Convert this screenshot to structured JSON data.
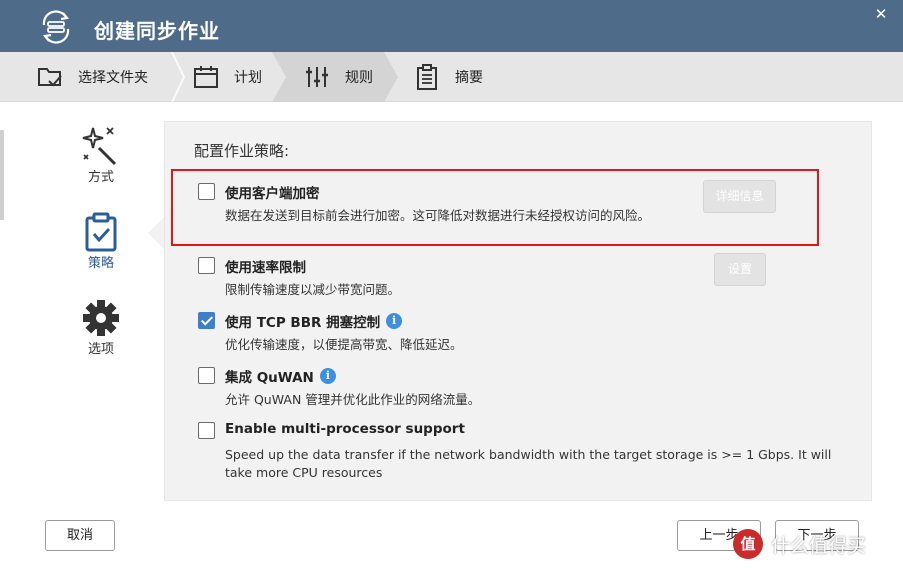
{
  "window": {
    "title": "创建同步作业",
    "close_glyph": "✕"
  },
  "steps": [
    {
      "label": "选择文件夹",
      "icon": "folder-check-icon"
    },
    {
      "label": "计划",
      "icon": "calendar-icon"
    },
    {
      "label": "规则",
      "icon": "sliders-icon",
      "active": true
    },
    {
      "label": "摘要",
      "icon": "clipboard-list-icon"
    }
  ],
  "sidenav": [
    {
      "label": "方式",
      "icon": "magic-wand-icon"
    },
    {
      "label": "策略",
      "icon": "clipboard-check-icon",
      "active": true
    },
    {
      "label": "选项",
      "icon": "gear-icon"
    }
  ],
  "section_title": "配置作业策略:",
  "options": [
    {
      "label": "使用客户端加密",
      "checked": false,
      "desc": "数据在发送到目标前会进行加密。这可降低对数据进行未经授权访问的风险。",
      "info": false
    },
    {
      "label": "使用速率限制",
      "checked": false,
      "desc": "限制传输速度以减少带宽问题。",
      "info": false
    },
    {
      "label": "使用 TCP BBR 拥塞控制",
      "checked": true,
      "desc": "优化传输速度，以便提高带宽、降低延迟。",
      "info": true
    },
    {
      "label": "集成 QuWAN",
      "checked": false,
      "desc": "允许 QuWAN 管理并优化此作业的网络流量。",
      "info": true
    },
    {
      "label": "Enable multi-processor support",
      "checked": false,
      "desc": "Speed up the data transfer if the network bandwidth with the target storage is >= 1 Gbps. It will take more CPU resources",
      "info": false
    }
  ],
  "buttons": {
    "details": "详细信息",
    "settings": "设置",
    "cancel": "取消",
    "prev": "上一步",
    "next": "下一步"
  },
  "info_glyph": "i",
  "watermark": {
    "text": "什么值得买",
    "badge": "值"
  },
  "colors": {
    "titlebar": "#4e6c8a",
    "accent": "#3f7fc9",
    "highlight": "#e4161a",
    "panel": "#f2f2f2"
  }
}
